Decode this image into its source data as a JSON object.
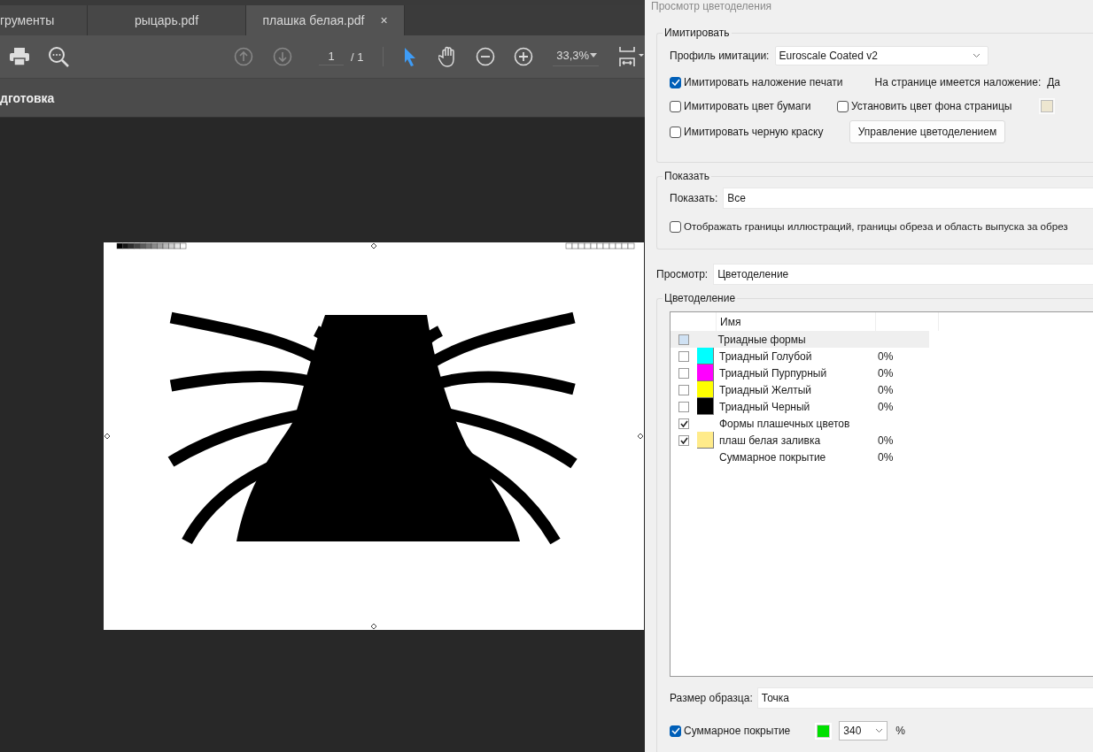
{
  "tabs": [
    {
      "label": "грументы",
      "selected": false
    },
    {
      "label": "рыцарь.pdf",
      "selected": false
    },
    {
      "label": "плашка белая.pdf",
      "selected": true,
      "close": "×"
    }
  ],
  "toolbar": {
    "page": "1",
    "page_total": "/ 1",
    "zoom": "33,3%"
  },
  "section_title": "дготовка",
  "panel": {
    "title": "Просмотр цветоделения",
    "simulate": {
      "legend": "Имитировать",
      "profile_label": "Профиль имитации:",
      "profile_value": "Euroscale Coated v2",
      "overprint": {
        "label": "Имитировать наложение печати",
        "checked": true
      },
      "overprint_status": {
        "label": "На странице имеется наложение:",
        "value": "Да"
      },
      "paper_color": {
        "label": "Имитировать цвет бумаги",
        "checked": false
      },
      "page_background": {
        "label": "Установить цвет фона страницы",
        "checked": false
      },
      "black_ink": {
        "label": "Имитировать черную краску",
        "checked": false
      },
      "manage_button": "Управление цветоделением"
    },
    "show": {
      "legend": "Показать",
      "label": "Показать:",
      "value": "Все",
      "boxes": {
        "label": "Отображать границы иллюстраций, границы обреза и область выпуска за обрез",
        "checked": false
      }
    },
    "preview": {
      "label": "Просмотр:",
      "value": "Цветоделение"
    },
    "separations": {
      "legend": "Цветоделение",
      "column": "Имя",
      "rows": [
        {
          "kind": "group",
          "name": "Триадные формы",
          "checked": false,
          "partial": true,
          "selected": true
        },
        {
          "kind": "ink",
          "name": "Триадный Голубой",
          "coverage": "0%",
          "checked": false,
          "partial": false,
          "selected": false,
          "color": "#00ffff"
        },
        {
          "kind": "ink",
          "name": "Триадный Пурпурный",
          "coverage": "0%",
          "checked": false,
          "partial": false,
          "selected": false,
          "color": "#ff00ff"
        },
        {
          "kind": "ink",
          "name": "Триадный Желтый",
          "coverage": "0%",
          "checked": false,
          "partial": false,
          "selected": false,
          "color": "#ffff00"
        },
        {
          "kind": "ink",
          "name": "Триадный Черный",
          "coverage": "0%",
          "checked": false,
          "partial": false,
          "selected": false,
          "color": "#000000"
        },
        {
          "kind": "group",
          "name": "Формы плашечных цветов",
          "checked": true,
          "partial": false,
          "selected": false
        },
        {
          "kind": "ink",
          "name": "плаш белая заливка",
          "coverage": "0%",
          "checked": true,
          "partial": false,
          "selected": false,
          "color": "#ffeb8a"
        },
        {
          "kind": "total",
          "name": "Суммарное покрытие",
          "coverage": "0%",
          "selected": false
        }
      ]
    },
    "sample": {
      "label": "Размер образца:",
      "value": "Точка"
    },
    "total": {
      "label": "Суммарное покрытие",
      "checked": true,
      "value": "340",
      "unit": "%"
    }
  }
}
